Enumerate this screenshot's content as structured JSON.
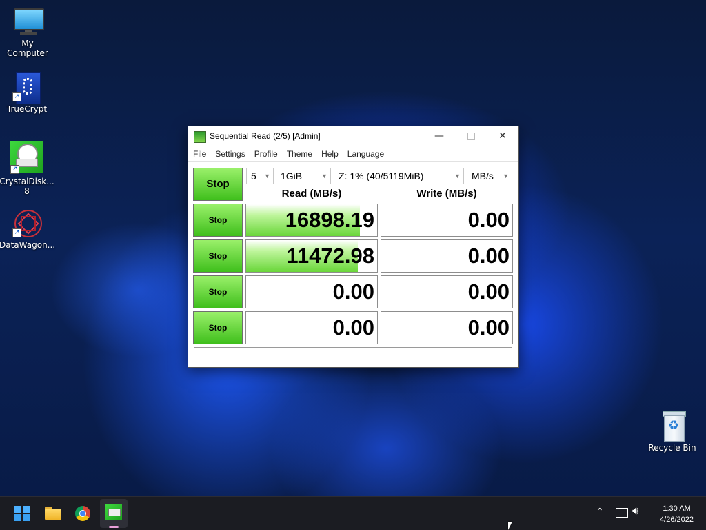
{
  "desktop": {
    "icons": [
      {
        "label": "My Computer",
        "icon": "monitor-icon"
      },
      {
        "label": "TrueCrypt",
        "icon": "truecrypt-icon"
      },
      {
        "label": "CrystalDisk...\n8",
        "icon": "crystaldisk-icon"
      },
      {
        "label": "DataWagon...",
        "icon": "datawagon-icon"
      },
      {
        "label": "Recycle Bin",
        "icon": "recycle-bin-icon"
      }
    ]
  },
  "window": {
    "title": "Sequential Read (2/5) [Admin]",
    "menu": [
      "File",
      "Settings",
      "Profile",
      "Theme",
      "Help",
      "Language"
    ],
    "controls": {
      "all_button": "Stop",
      "count": "5",
      "size": "1GiB",
      "drive": "Z: 1% (40/5119MiB)",
      "unit": "MB/s"
    },
    "headers": {
      "read": "Read (MB/s)",
      "write": "Write (MB/s)"
    },
    "rows": [
      {
        "button": "Stop",
        "read": "16898.19",
        "write": "0.00",
        "read_fill": 0.87
      },
      {
        "button": "Stop",
        "read": "11472.98",
        "write": "0.00",
        "read_fill": 0.85
      },
      {
        "button": "Stop",
        "read": "0.00",
        "write": "0.00",
        "read_fill": 0
      },
      {
        "button": "Stop",
        "read": "0.00",
        "write": "0.00",
        "read_fill": 0
      }
    ],
    "comment": ""
  },
  "taskbar": {
    "time": "1:30 AM",
    "date": "4/26/2022"
  },
  "colors": {
    "accent_green": "#3fbf1c",
    "taskbar": "#1b1c22"
  }
}
